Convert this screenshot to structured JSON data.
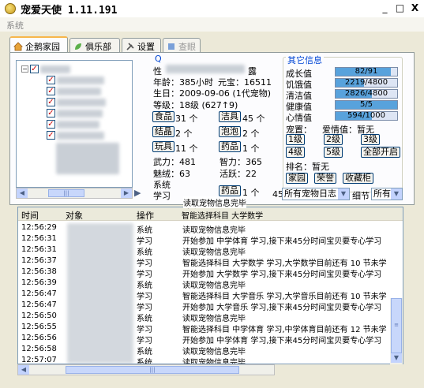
{
  "window": {
    "title": "宠爱天使 1.11.191",
    "minimize": "_",
    "maximize": "□",
    "close": "X"
  },
  "menu": {
    "system": "系统"
  },
  "tabs": [
    {
      "label": "企鹅家园",
      "icon": "home-icon"
    },
    {
      "label": "俱乐部",
      "icon": "leaf-icon"
    },
    {
      "label": "设置",
      "icon": "tools-icon"
    },
    {
      "label": "查眼",
      "icon": "paint-icon"
    }
  ],
  "pet_info": {
    "section_letter": "Q",
    "gender_label": "性",
    "name_tail": "露",
    "age": "年龄：385小时",
    "yuanbao": "元宝：16511",
    "birthday": "生日：2009-09-06 (1代宠物)",
    "level": "等级：18级 (627↑9)",
    "food_btn": "食品",
    "food_count": "31 个",
    "clean_btn": "洁具",
    "clean_count": "45 个",
    "ball_btn": "结晶",
    "ball_count": "2 个",
    "bubble_btn": "泡泡",
    "bubble_count": "2 个",
    "toy_btn": "玩具",
    "toy_count": "11 个",
    "medicine_btn": "药品",
    "medicine_count": "1 个",
    "force": "武力：481",
    "intellect": "智力：365",
    "charm_label": "魅绒：63",
    "active": "活跃：22",
    "system_label": "系统",
    "study_label": "学习",
    "medicine2_btn": "药品",
    "medicine2_count": "1 个"
  },
  "other_info": {
    "title": "其它信息",
    "growth_label": "成长值",
    "growth_value": "82/91",
    "growth_fraction": 0.9,
    "hunger_label": "饥饿值",
    "hunger_value": "2219/4800",
    "hunger_fraction": 0.46,
    "clean_label": "清洁值",
    "clean_value": "2826/4800",
    "clean_fraction": 0.59,
    "health_label": "健康值",
    "health_value": "5/5",
    "health_fraction": 1.0,
    "mood_label": "心情值",
    "mood_value": "594/1000",
    "mood_fraction": 0.59,
    "pet_label": "宠置：",
    "love_label": "爱情值：暂无",
    "lv1": "1级",
    "lv2": "2级",
    "lv3": "3级",
    "lv4": "4级",
    "lv5": "5级",
    "open_all": "全部开启",
    "rank": "排名：暂无",
    "home_btn": "家园",
    "shop_btn": "荣誉",
    "collect_btn": "收藏柜"
  },
  "log_toolbar": {
    "count": "45",
    "log_filter": "所有宠物日志",
    "detail_label": "细节",
    "all_filter": "所有"
  },
  "log": {
    "headers": {
      "time": "时间",
      "target": "对象",
      "op": "操作",
      "detail": "详细"
    },
    "overlay_rows": [
      {
        "op": "",
        "msg": "读取宠物信息完毕"
      },
      {
        "op": "",
        "msg": "智能选择科目 大学数学"
      }
    ],
    "rows": [
      {
        "time": "12:56:29",
        "op": "系统",
        "msg": "读取宠物信息完毕"
      },
      {
        "time": "12:56:31",
        "op": "学习",
        "msg": "开始参加 中学体育 学习,接下来45分时间宝贝要专心学习"
      },
      {
        "time": "12:56:31",
        "op": "系统",
        "msg": "读取宠物信息完毕"
      },
      {
        "time": "12:56:37",
        "op": "学习",
        "msg": "智能选择科目 大学数学 学习,大学数学目前还有 10 节未学"
      },
      {
        "time": "12:56:38",
        "op": "学习",
        "msg": "开始参加 大学数学 学习,接下来45分时间宝贝要专心学习"
      },
      {
        "time": "12:56:39",
        "op": "系统",
        "msg": "读取宠物信息完毕"
      },
      {
        "time": "12:56:47",
        "op": "学习",
        "msg": "智能选择科目 大学音乐 学习,大学音乐目前还有 10 节未学"
      },
      {
        "time": "12:56:47",
        "op": "学习",
        "msg": "开始参加 大学音乐 学习,接下来45分时间宝贝要专心学习"
      },
      {
        "time": "12:56:50",
        "op": "系统",
        "msg": "读取宠物信息完毕"
      },
      {
        "time": "12:56:55",
        "op": "学习",
        "msg": "智能选择科目 中学体育 学习,中学体育目前还有 12 节未学"
      },
      {
        "time": "12:56:56",
        "op": "学习",
        "msg": "开始参加 中学体育 学习,接下来45分时间宝贝要专心学习"
      },
      {
        "time": "12:56:58",
        "op": "系统",
        "msg": "读取宠物信息完毕"
      },
      {
        "time": "12:57:07",
        "op": "系统",
        "msg": "读取宠物信息完毕"
      }
    ]
  }
}
